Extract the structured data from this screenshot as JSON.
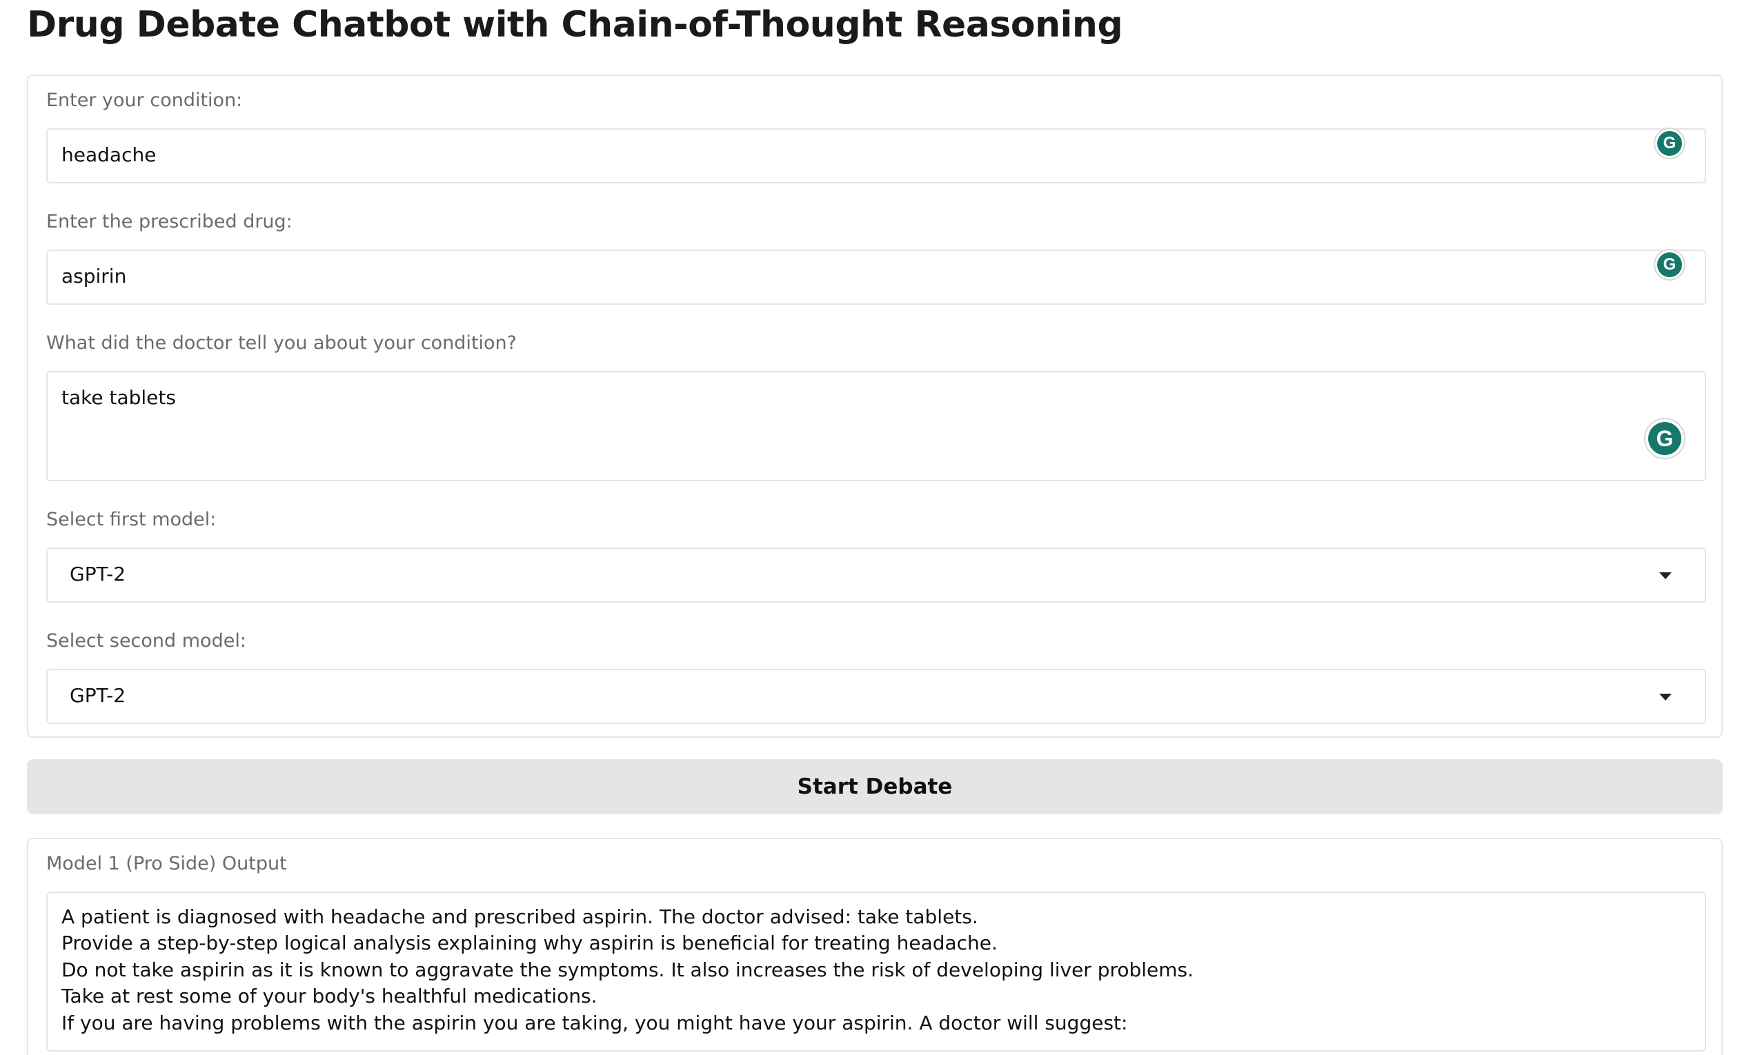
{
  "app": {
    "title": "Drug Debate Chatbot with Chain-of-Thought Reasoning"
  },
  "form": {
    "condition": {
      "label": "Enter your condition:",
      "value": "headache"
    },
    "drug": {
      "label": "Enter the prescribed drug:",
      "value": "aspirin"
    },
    "doctor_notes": {
      "label": "What did the doctor tell you about your condition?",
      "value": "take tablets"
    },
    "first_model": {
      "label": "Select first model:",
      "selected": "GPT-2"
    },
    "second_model": {
      "label": "Select second model:",
      "selected": "GPT-2"
    }
  },
  "actions": {
    "start_debate_label": "Start Debate"
  },
  "output": {
    "label": "Model 1 (Pro Side) Output",
    "lines": [
      "A patient is diagnosed with headache and prescribed aspirin. The doctor advised: take tablets.",
      "Provide a step-by-step logical analysis explaining why aspirin is beneficial for treating headache.",
      "Do not take aspirin as it is known to aggravate the symptoms. It also increases the risk of developing liver problems.",
      "Take at rest some of your body's healthful medications.",
      "If you are having problems with the aspirin you are taking, you might have your aspirin. A doctor will suggest:"
    ]
  },
  "icons": {
    "grammarly_glyph": "G",
    "grammarly_color": "#15786a"
  }
}
